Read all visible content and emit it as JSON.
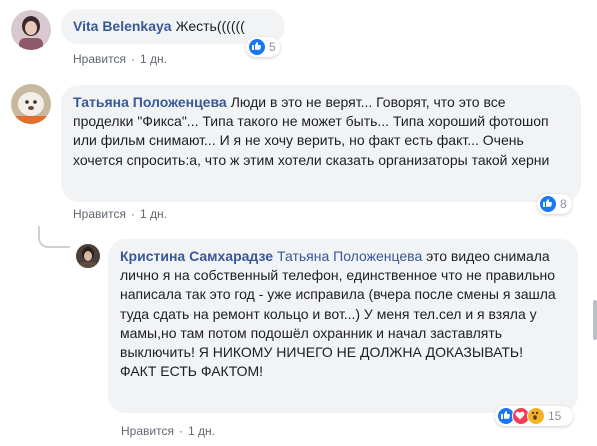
{
  "comments": [
    {
      "author": "Vita Belenkaya",
      "text": "Жесть((((((",
      "like_label": "Нравится",
      "time": "1 дн.",
      "reaction_count": "5",
      "reactions": [
        "like-icon"
      ]
    },
    {
      "author": "Татьяна Положенцева",
      "text": "Люди в это не верят... Говорят, что это все проделки \"Фикса\"... Типа такого не может быть... Типа хороший фотошоп или фильм снимают... И я не хочу верить, но факт есть факт... Очень хочется спросить:а, что ж этим хотели сказать организаторы такой херни",
      "like_label": "Нравится",
      "time": "1 дн.",
      "reaction_count": "8",
      "reactions": [
        "like-icon"
      ]
    },
    {
      "author": "Кристина Самхарадзе",
      "mention": "Татьяна Положенцева",
      "text": "это видео снимала лично я на собственный телефон, единственное что не правильно написала так это год - уже исправила (вчера после смены я зашла туда сдать на ремонт кольцо и вот...) У меня тел.сел и я взяла у мамы,но там потом подошёл охранник и начал заставлять выключить! Я НИКОМУ НИЧЕГО НЕ ДОЛЖНА ДОКАЗЫВАТЬ! ФАКТ ЕСТЬ ФАКТОМ!",
      "like_label": "Нравится",
      "time": "1 дн.",
      "reaction_count": "15",
      "reactions": [
        "like-icon",
        "love-icon",
        "wow-icon"
      ]
    }
  ],
  "colors": {
    "link": "#385898",
    "bubble": "#f2f3f5",
    "meta": "#606770",
    "like": "#1877f2",
    "love": "#f33e58",
    "wow": "#f7b125"
  }
}
